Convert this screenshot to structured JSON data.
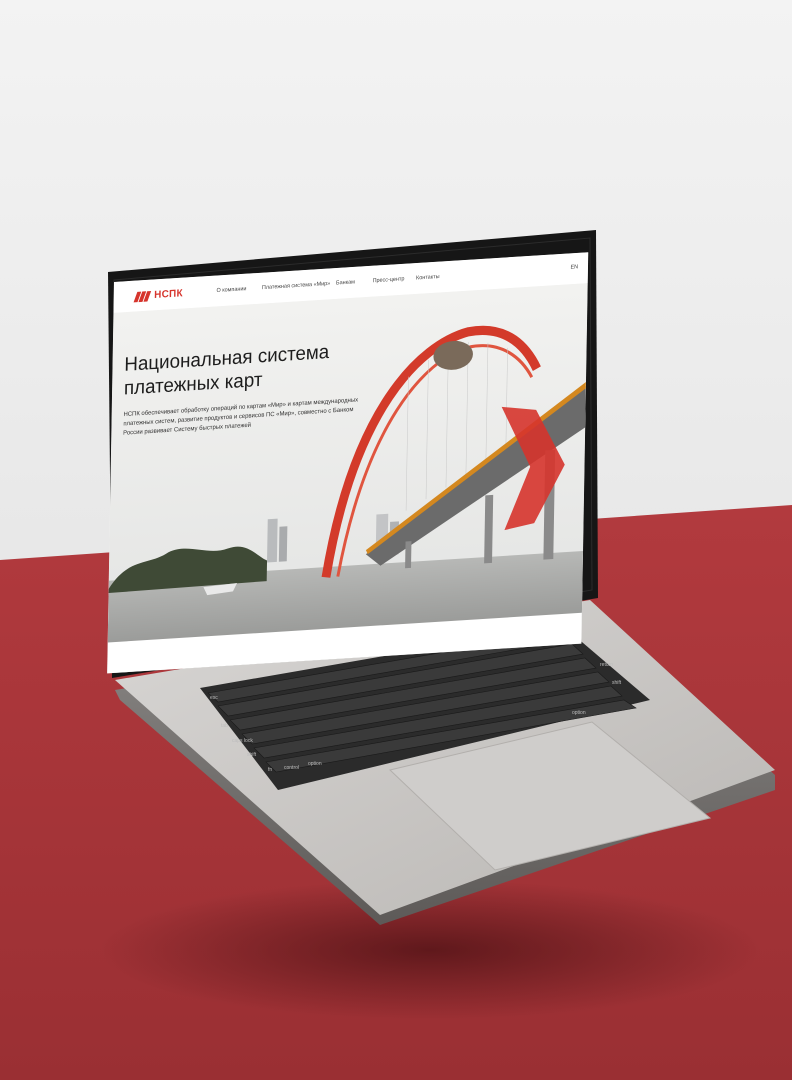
{
  "site": {
    "logo_text": "НСПК",
    "nav": {
      "items": [
        {
          "label": "О компании"
        },
        {
          "label": "Платежная система «Мир»"
        },
        {
          "label": "Банкам"
        },
        {
          "label": "Пресс-центр"
        },
        {
          "label": "Контакты"
        }
      ],
      "lang": "EN"
    },
    "hero": {
      "title": "Национальная система платежных карт",
      "subtitle": "НСПК обеспечивает обработку операций по картам «Мир» и картам международных платежных систем, развитие продуктов и сервисов ПС «Мир», совместно с Банком России развивает Систему быстрых платежей"
    }
  },
  "keyboard": {
    "keys": [
      "esc",
      "tab",
      "caps lock",
      "shift",
      "fn",
      "control",
      "option",
      "delete",
      "return",
      "shift",
      "option"
    ]
  },
  "colors": {
    "brand_red": "#d6342c",
    "table_red": "#a8363a",
    "laptop_silver": "#c9c7c5"
  }
}
